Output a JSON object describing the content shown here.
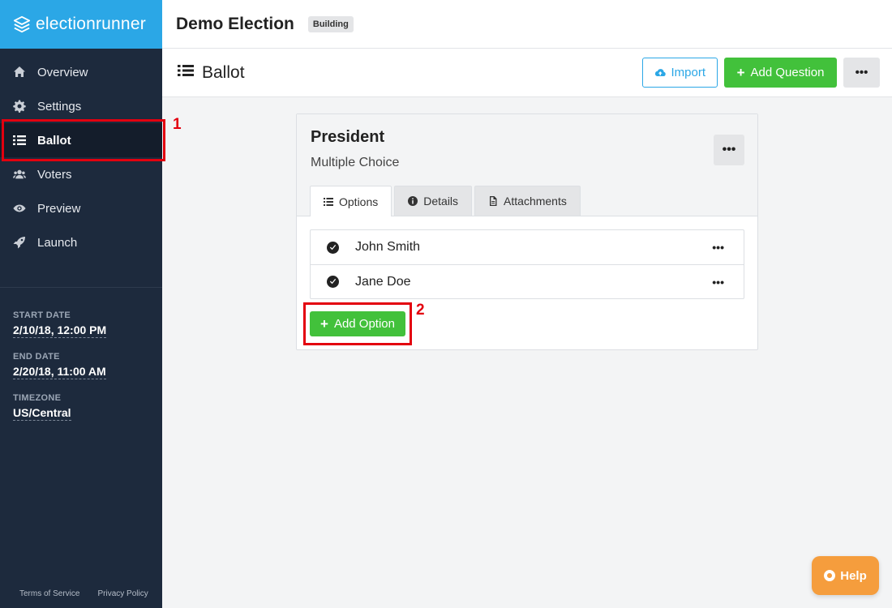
{
  "app": {
    "brand": "electionrunner"
  },
  "sidebar": {
    "items": [
      {
        "label": "Overview",
        "icon": "home-icon"
      },
      {
        "label": "Settings",
        "icon": "gear-icon"
      },
      {
        "label": "Ballot",
        "icon": "list-icon",
        "active": true
      },
      {
        "label": "Voters",
        "icon": "users-icon"
      },
      {
        "label": "Preview",
        "icon": "eye-icon"
      },
      {
        "label": "Launch",
        "icon": "rocket-icon"
      }
    ],
    "start_date_label": "START DATE",
    "start_date": "2/10/18, 12:00 PM",
    "end_date_label": "END DATE",
    "end_date": "2/20/18, 11:00 AM",
    "timezone_label": "TIMEZONE",
    "timezone": "US/Central",
    "footer": {
      "terms": "Terms of Service",
      "privacy": "Privacy Policy"
    }
  },
  "header": {
    "election_title": "Demo Election",
    "status_badge": "Building"
  },
  "page": {
    "title": "Ballot",
    "import_label": "Import",
    "add_question_label": "Add Question",
    "more_label": "•••"
  },
  "question": {
    "title": "President",
    "type": "Multiple Choice",
    "more_label": "•••",
    "tabs": [
      {
        "label": "Options",
        "icon": "list-icon",
        "active": true
      },
      {
        "label": "Details",
        "icon": "info-icon"
      },
      {
        "label": "Attachments",
        "icon": "file-icon"
      }
    ],
    "options": [
      {
        "name": "John Smith",
        "more_label": "•••"
      },
      {
        "name": "Jane Doe",
        "more_label": "•••"
      }
    ],
    "add_option_label": "Add Option"
  },
  "annotations": {
    "marker_1": "1",
    "marker_2": "2"
  },
  "help": {
    "label": "Help"
  },
  "colors": {
    "sidebar_bg": "#1d2a3d",
    "brand_blue": "#2ba7e6",
    "green": "#42c13b",
    "highlight_red": "#e3000f",
    "help_orange": "#f59d3d"
  }
}
